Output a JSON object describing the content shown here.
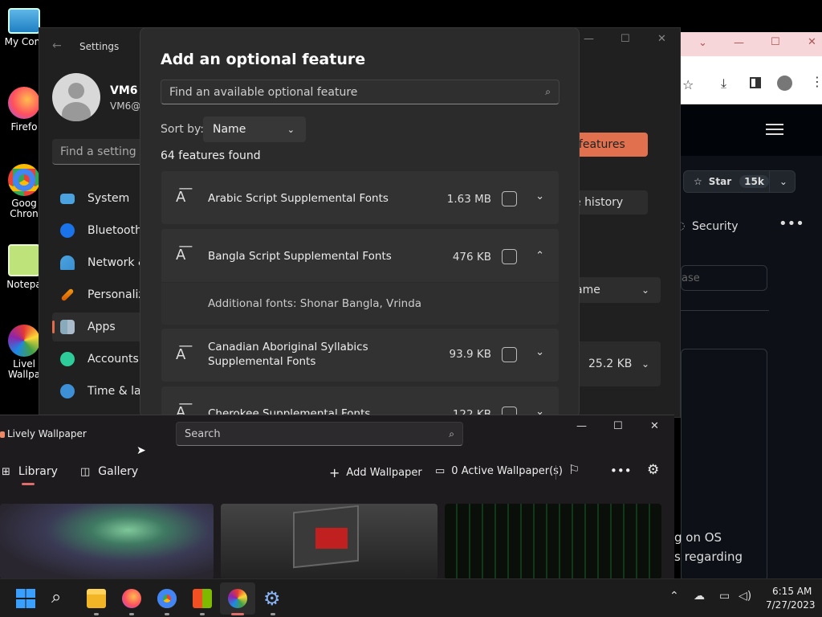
{
  "desktop": {
    "icons": [
      {
        "label": "My Com",
        "icon": "computer-icon"
      },
      {
        "label": "Firefo",
        "icon": "firefox-icon"
      },
      {
        "label": "Goog Chron",
        "icon": "chrome-icon"
      },
      {
        "label": "Notepa",
        "icon": "notepad-icon"
      },
      {
        "label": "Livel Wallpa",
        "icon": "lively-icon"
      }
    ]
  },
  "browser": {
    "star_label": "Star",
    "star_count": "15k",
    "new_features_fragment": "w features",
    "history_fragment": "e history",
    "security_label": "Security",
    "name_fragment": "ame",
    "search_fragment": "ase",
    "size_fragment": "25.2 KB",
    "text_line1": "g on OS",
    "text_line2": "s regarding"
  },
  "settings": {
    "title": "Settings",
    "user_name": "VM6",
    "user_email": "VM6@c",
    "search_placeholder": "Find a setting",
    "nav": [
      {
        "label": "System"
      },
      {
        "label": "Bluetooth &"
      },
      {
        "label": "Network &"
      },
      {
        "label": "Personaliza"
      },
      {
        "label": "Apps"
      },
      {
        "label": "Accounts"
      },
      {
        "label": "Time & lan"
      }
    ]
  },
  "dialog": {
    "title": "Add an optional feature",
    "search_placeholder": "Find an available optional feature",
    "sort_label": "Sort by:",
    "sort_value": "Name",
    "count_text": "64 features found",
    "features": [
      {
        "name": "Arabic Script Supplemental Fonts",
        "size": "1.63 MB",
        "expanded": false
      },
      {
        "name": "Bangla Script Supplemental Fonts",
        "size": "476 KB",
        "expanded": true,
        "detail": "Additional fonts: Shonar Bangla, Vrinda"
      },
      {
        "name": "Canadian Aboriginal Syllabics Supplemental Fonts",
        "size": "93.9 KB",
        "expanded": false
      },
      {
        "name": "Cherokee Supplemental Fonts",
        "size": "122 KB",
        "expanded": false
      }
    ]
  },
  "lively": {
    "title": "Lively Wallpaper",
    "search_placeholder": "Search",
    "tab_library": "Library",
    "tab_gallery": "Gallery",
    "add_wallpaper": "Add Wallpaper",
    "active_wallpapers": "0 Active Wallpaper(s)"
  },
  "taskbar": {
    "apps": [
      "windows-start-icon",
      "search-icon",
      "file-explorer-icon",
      "firefox-icon",
      "chrome-icon",
      "store-icon",
      "lively-icon",
      "settings-icon"
    ],
    "time": "6:15 AM",
    "date": "7/27/2023"
  }
}
